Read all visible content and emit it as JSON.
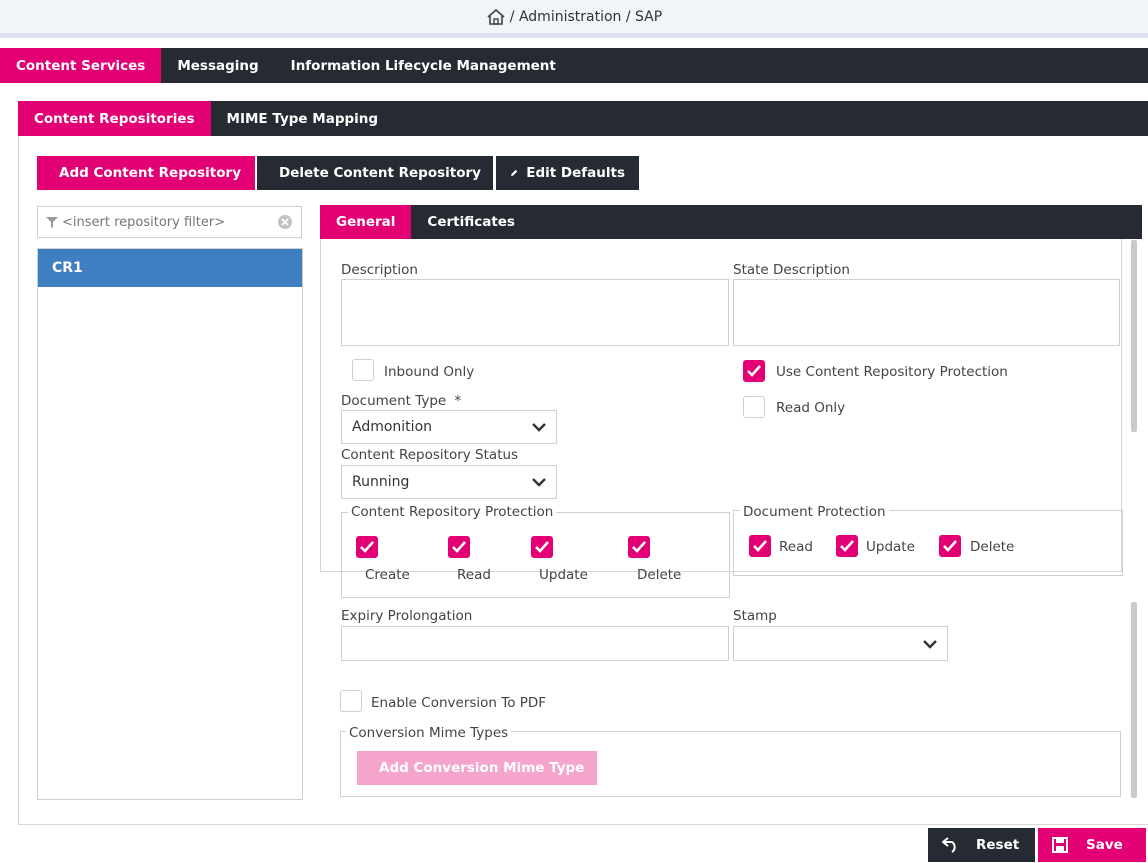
{
  "breadcrumb": {
    "path": "/ Administration / SAP"
  },
  "main_tabs": [
    {
      "label": "Content Services",
      "active": true
    },
    {
      "label": "Messaging",
      "active": false
    },
    {
      "label": "Information Lifecycle Management",
      "active": false
    }
  ],
  "sub_tabs": [
    {
      "label": "Content Repositories",
      "active": true
    },
    {
      "label": "MIME Type Mapping",
      "active": false
    }
  ],
  "toolbar": {
    "add_label": "Add Content Repository",
    "delete_label": "Delete Content Repository",
    "edit_label": "Edit Defaults"
  },
  "filter": {
    "placeholder": "<insert repository filter>"
  },
  "repositories": [
    {
      "label": "CR1",
      "selected": true
    }
  ],
  "detail_tabs": [
    {
      "label": "General",
      "active": true
    },
    {
      "label": "Certificates",
      "active": false
    }
  ],
  "form": {
    "description_label": "Description",
    "state_description_label": "State Description",
    "inbound_only_label": "Inbound Only",
    "inbound_only_checked": false,
    "use_protection_label": "Use Content Repository Protection",
    "use_protection_checked": true,
    "read_only_label": "Read Only",
    "read_only_checked": false,
    "document_type_label": "Document Type",
    "required_mark": "*",
    "document_type_value": "Admonition",
    "status_label": "Content Repository Status",
    "status_value": "Running",
    "cr_protection": {
      "legend": "Content Repository Protection",
      "items": [
        {
          "label": "Create",
          "checked": true
        },
        {
          "label": "Read",
          "checked": true
        },
        {
          "label": "Update",
          "checked": true
        },
        {
          "label": "Delete",
          "checked": true
        }
      ]
    },
    "doc_protection": {
      "legend": "Document Protection",
      "items": [
        {
          "label": "Read",
          "checked": true
        },
        {
          "label": "Update",
          "checked": true
        },
        {
          "label": "Delete",
          "checked": true
        }
      ]
    },
    "expiry_label": "Expiry Prolongation",
    "expiry_value": "",
    "stamp_label": "Stamp",
    "stamp_value": "",
    "enable_pdf_label": "Enable Conversion To PDF",
    "enable_pdf_checked": false,
    "conversion_legend": "Conversion Mime Types",
    "add_conversion_label": "Add Conversion Mime Type"
  },
  "footer": {
    "reset_label": "Reset",
    "save_label": "Save"
  },
  "colors": {
    "accent": "#e20074",
    "dark": "#262b33",
    "selected": "#3f7fc1"
  },
  "icons": [
    "home-icon",
    "plus-icon",
    "minus-icon",
    "pencil-icon",
    "filter-icon",
    "clear-icon",
    "check-icon",
    "chevron-down-icon",
    "undo-icon",
    "save-icon"
  ]
}
